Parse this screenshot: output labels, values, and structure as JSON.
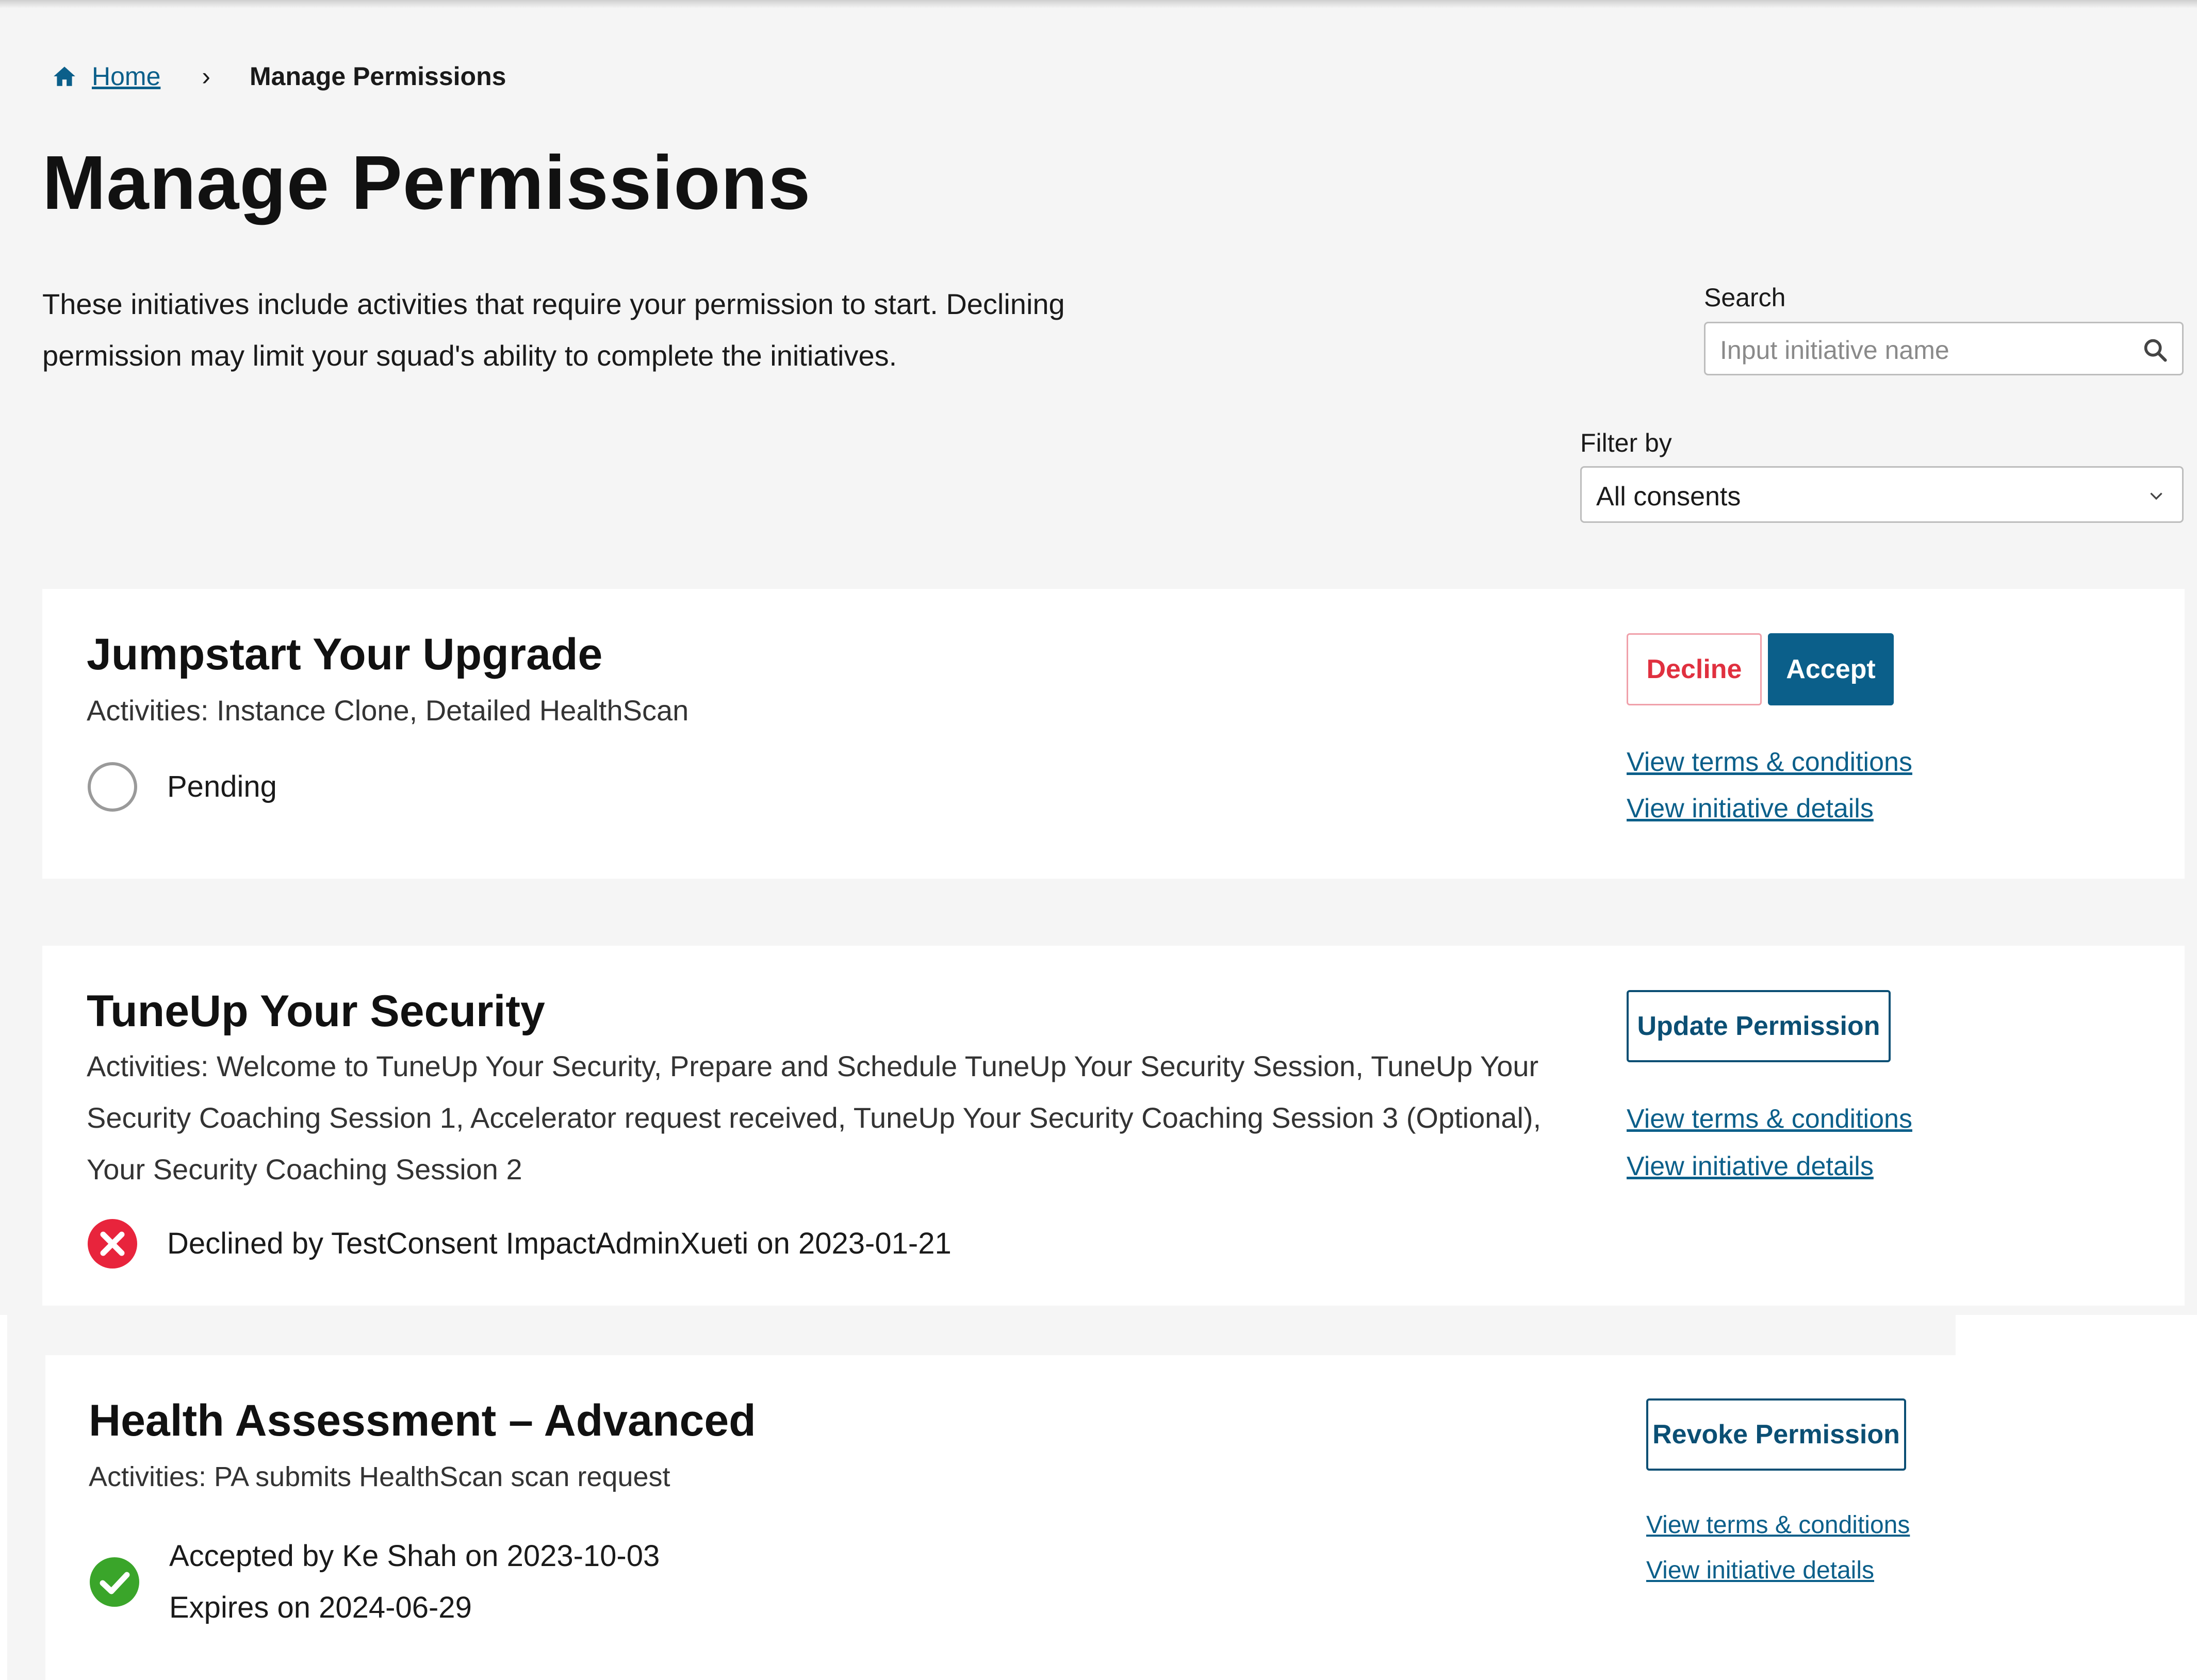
{
  "breadcrumb": {
    "home_label": "Home",
    "separator": "›",
    "current": "Manage Permissions"
  },
  "page": {
    "title": "Manage Permissions",
    "intro_line1": "These initiatives include activities that require your permission to start. Declining",
    "intro_line2": "permission may limit your squad's ability to complete the initiatives."
  },
  "search": {
    "label": "Search",
    "placeholder": "Input initiative name",
    "value": ""
  },
  "filter": {
    "label": "Filter by",
    "selected": "All consents"
  },
  "cards": [
    {
      "title": "Jumpstart Your Upgrade",
      "activities": "Activities: Instance Clone, Detailed HealthScan",
      "status": "pending",
      "status_lines": [
        "Pending"
      ],
      "buttons": [
        "Decline",
        "Accept"
      ],
      "links": [
        "View terms & conditions",
        "View initiative details"
      ]
    },
    {
      "title": "TuneUp Your Security",
      "activities_lines": [
        "Activities: Welcome to TuneUp Your Security, Prepare and Schedule TuneUp Your Security Session, TuneUp Your",
        "Security Coaching Session 1, Accelerator request received, TuneUp Your Security Coaching Session 3 (Optional),",
        "Your Security Coaching Session 2"
      ],
      "status": "declined",
      "status_lines": [
        "Declined by TestConsent ImpactAdminXueti on 2023-01-21"
      ],
      "buttons": [
        "Update Permission"
      ],
      "links": [
        "View terms & conditions",
        "View initiative details"
      ]
    },
    {
      "title": "Health Assessment – Advanced",
      "activities": "Activities: PA submits HealthScan scan request",
      "status": "accepted",
      "status_lines": [
        "Accepted by Ke  Shah on 2023-10-03",
        "Expires on 2024-06-29"
      ],
      "buttons": [
        "Revoke Permission"
      ],
      "links": [
        "View terms & conditions",
        "View initiative details"
      ]
    }
  ],
  "colors": {
    "brand": "#0b5f8a",
    "decline": "#e0303f",
    "declined_icon": "#e8243c",
    "accepted_icon": "#3aa52a",
    "page_bg": "#f5f5f5",
    "card_bg": "#ffffff"
  },
  "icons": {
    "home": "home-icon",
    "search": "search-icon",
    "chevron": "chevron-down-icon",
    "pending": "pending-circle-icon",
    "declined": "x-circle-icon",
    "accepted": "check-circle-icon"
  }
}
